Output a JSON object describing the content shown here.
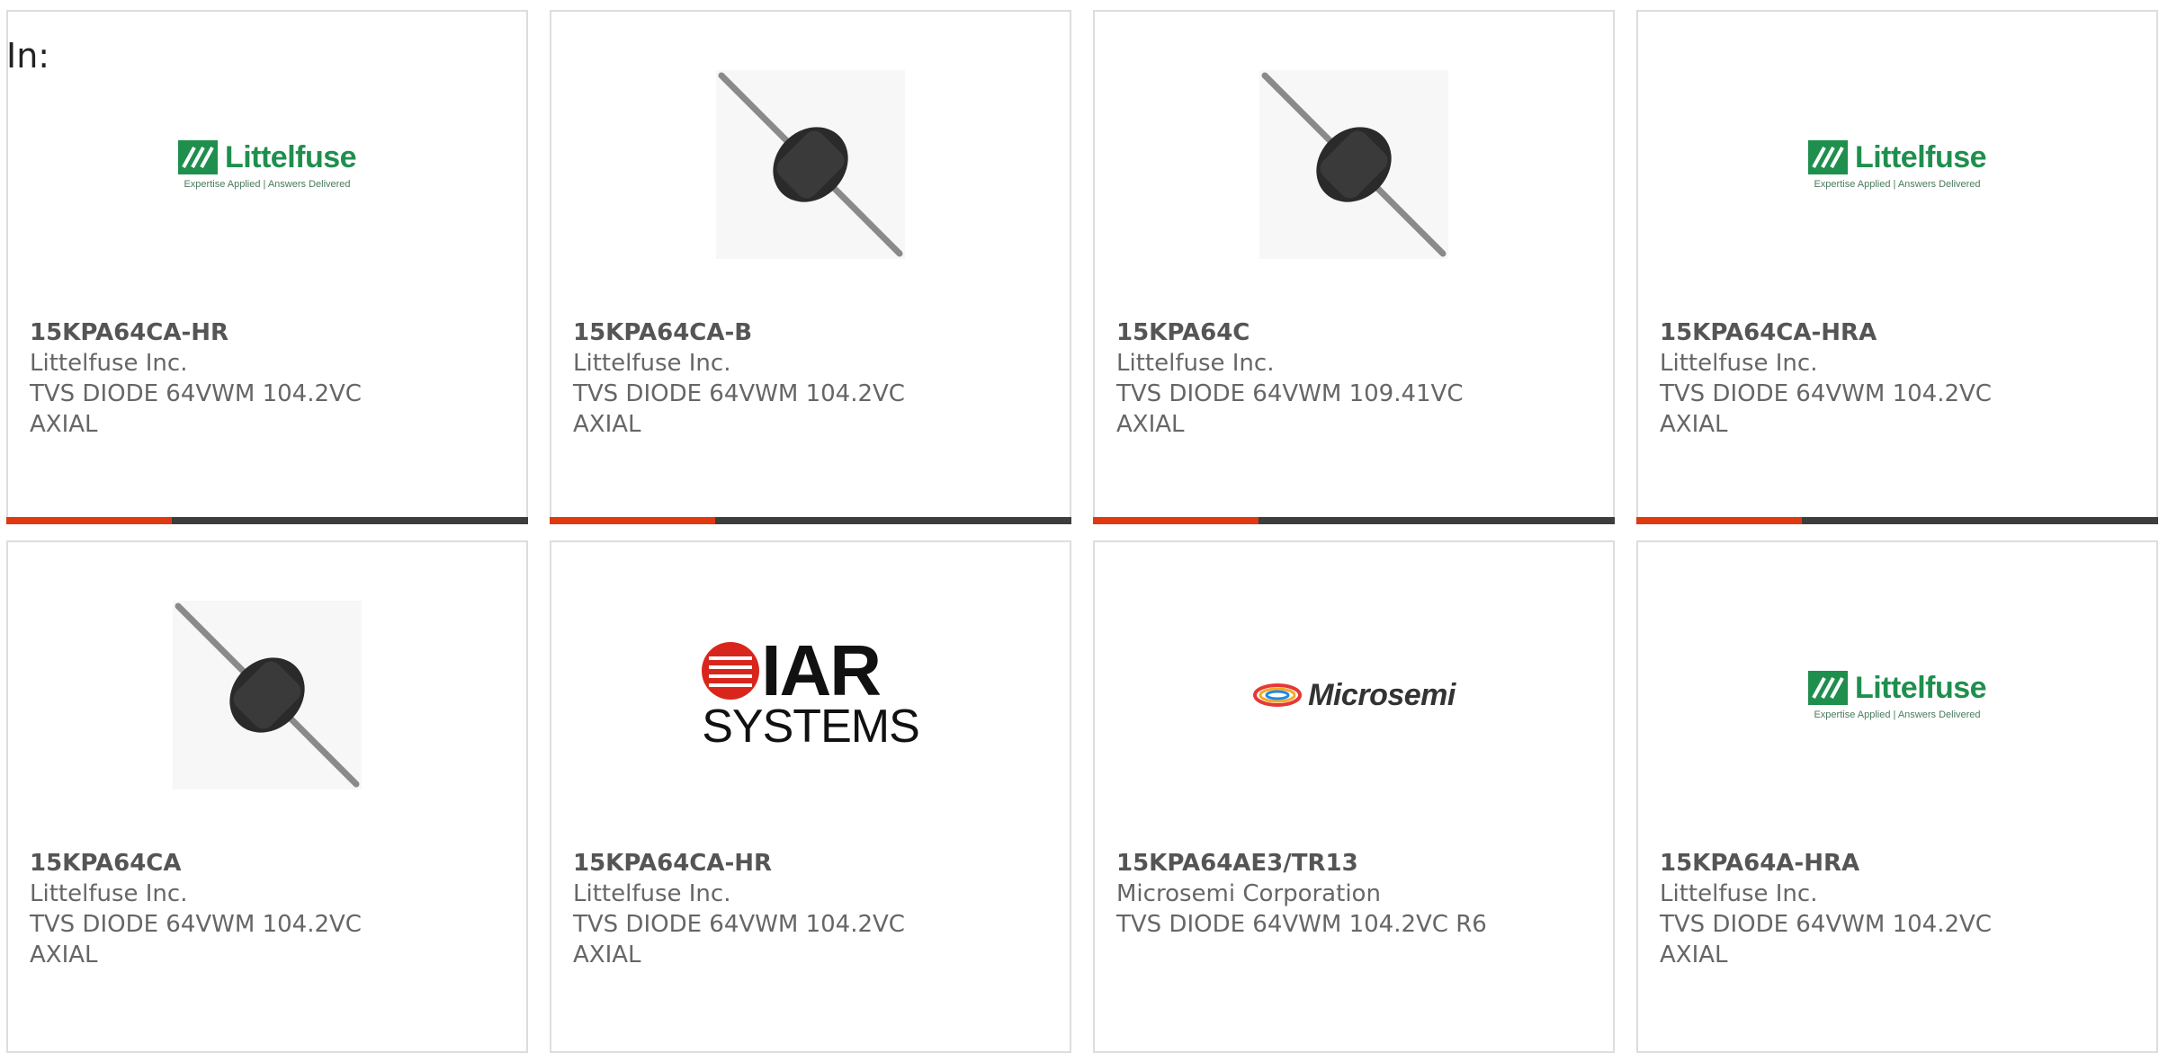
{
  "header": {
    "in_label": "In:"
  },
  "colors": {
    "accent": "#e0380f",
    "bar": "#3d3d3d",
    "littelfuse_green": "#1f8f4e",
    "iar_red": "#d9261c"
  },
  "products": [
    {
      "part": "15KPA64CA-HR",
      "manufacturer": "Littelfuse Inc.",
      "desc1": "TVS DIODE 64VWM 104.2VC",
      "desc2": "AXIAL",
      "image": "littelfuse-logo",
      "logo": {
        "name": "Littelfuse",
        "tagline": "Expertise Applied | Answers Delivered"
      }
    },
    {
      "part": "15KPA64CA-B",
      "manufacturer": "Littelfuse Inc.",
      "desc1": "TVS DIODE 64VWM 104.2VC",
      "desc2": "AXIAL",
      "image": "axial-diode-photo"
    },
    {
      "part": "15KPA64C",
      "manufacturer": "Littelfuse Inc.",
      "desc1": "TVS DIODE 64VWM 109.41VC",
      "desc2": "AXIAL",
      "image": "axial-diode-photo"
    },
    {
      "part": "15KPA64CA-HRA",
      "manufacturer": "Littelfuse Inc.",
      "desc1": "TVS DIODE 64VWM 104.2VC",
      "desc2": "AXIAL",
      "image": "littelfuse-logo",
      "logo": {
        "name": "Littelfuse",
        "tagline": "Expertise Applied | Answers Delivered"
      }
    },
    {
      "part": "15KPA64CA",
      "manufacturer": "Littelfuse Inc.",
      "desc1": "TVS DIODE 64VWM 104.2VC",
      "desc2": "AXIAL",
      "image": "axial-diode-photo"
    },
    {
      "part": "15KPA64CA-HR",
      "manufacturer": "Littelfuse Inc.",
      "desc1": "TVS DIODE 64VWM 104.2VC",
      "desc2": "AXIAL",
      "image": "iar-systems-logo",
      "logo": {
        "top": "IAR",
        "bottom": "SYSTEMS"
      }
    },
    {
      "part": "15KPA64AE3/TR13",
      "manufacturer": "Microsemi Corporation",
      "desc1": "TVS DIODE 64VWM 104.2VC R6",
      "desc2": "",
      "image": "microsemi-logo",
      "logo": {
        "name": "Microsemi"
      }
    },
    {
      "part": "15KPA64A-HRA",
      "manufacturer": "Littelfuse Inc.",
      "desc1": "TVS DIODE 64VWM 104.2VC",
      "desc2": "AXIAL",
      "image": "littelfuse-logo",
      "logo": {
        "name": "Littelfuse",
        "tagline": "Expertise Applied | Answers Delivered"
      }
    }
  ]
}
